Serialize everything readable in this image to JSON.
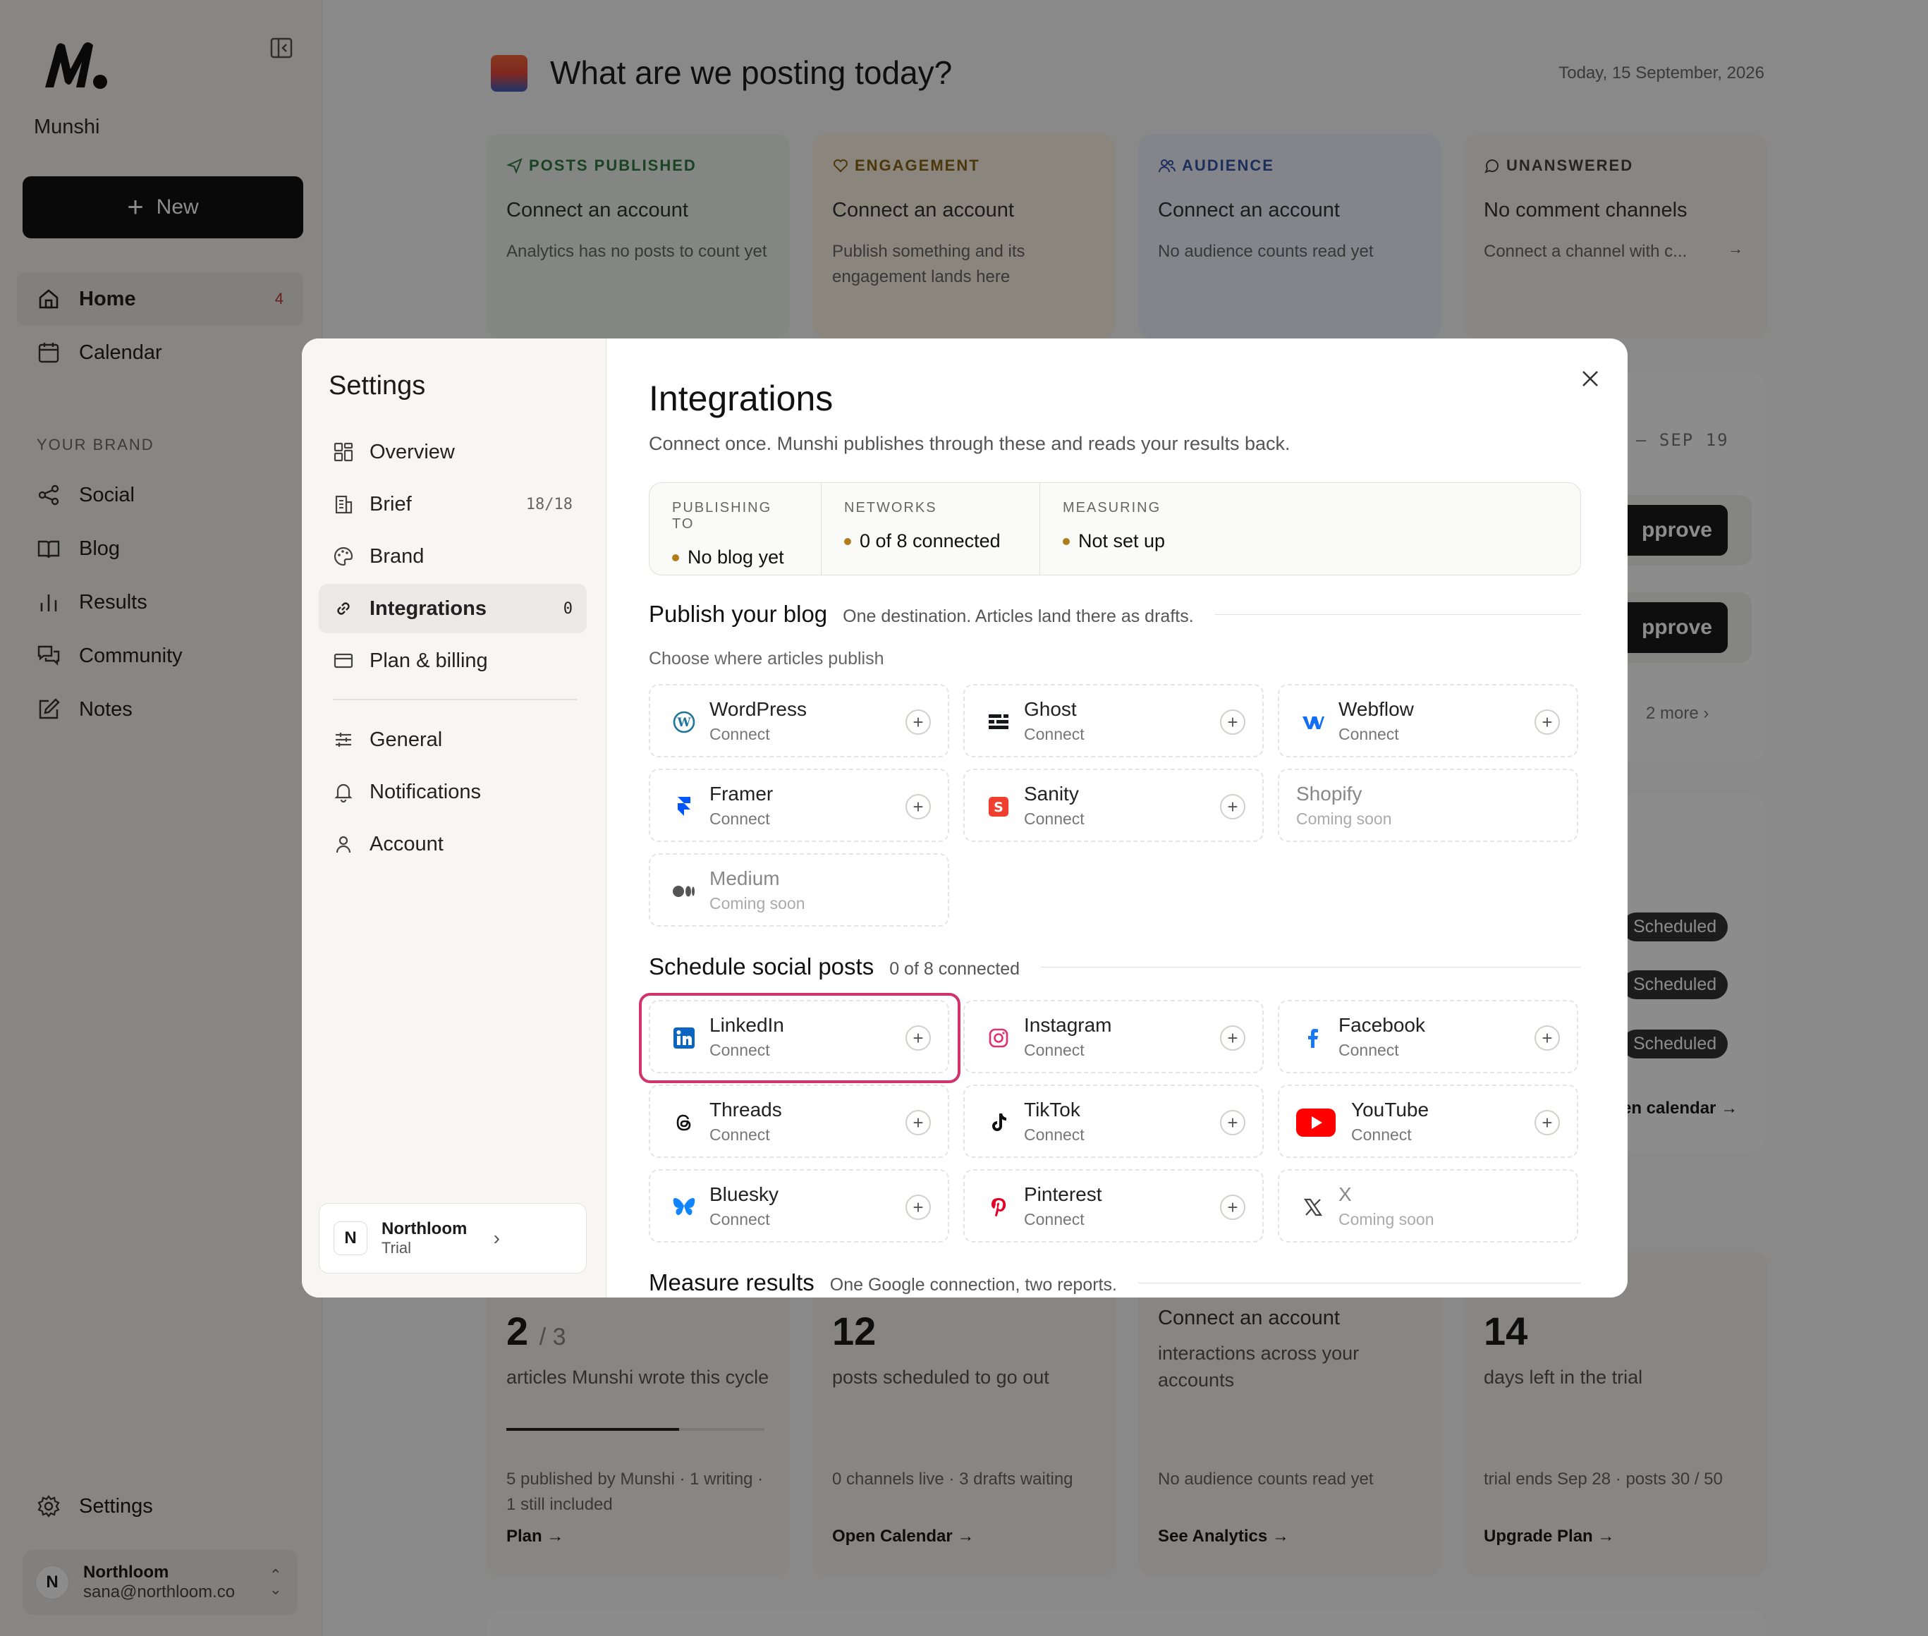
{
  "sidebar": {
    "brand": "Munshi",
    "new_label": "New",
    "nav": [
      {
        "label": "Home",
        "count": "4"
      },
      {
        "label": "Calendar"
      }
    ],
    "section_label": "YOUR BRAND",
    "brand_nav": [
      {
        "label": "Social"
      },
      {
        "label": "Blog"
      },
      {
        "label": "Results"
      },
      {
        "label": "Community"
      },
      {
        "label": "Notes"
      }
    ],
    "settings_label": "Settings",
    "user": {
      "initial": "N",
      "name": "Northloom",
      "email": "sana@northloom.co"
    }
  },
  "main": {
    "title": "What are we posting today?",
    "date": "Today, 15 September, 2026",
    "stats": [
      {
        "label": "POSTS PUBLISHED",
        "heading": "Connect an account",
        "desc": "Analytics has no posts to count yet",
        "color": "#2f7a3e",
        "bg": "#eef5ee"
      },
      {
        "label": "ENGAGEMENT",
        "heading": "Connect an account",
        "desc": "Publish something and its engagement lands here",
        "color": "#8a6414",
        "bg": "#fbf3e3"
      },
      {
        "label": "AUDIENCE",
        "heading": "Connect an account",
        "desc": "No audience counts read yet",
        "color": "#3455a8",
        "bg": "#eef2fb"
      },
      {
        "label": "UNANSWERED",
        "heading": "No comment channels",
        "desc": "Connect a channel with c...",
        "color": "#444444",
        "bg": "#f6f5f3"
      }
    ],
    "week_range": "– SEP 19",
    "approve_label": "pprove",
    "more_label": "2 more",
    "scheduled_label": "Scheduled",
    "open_calendar": "en calendar →",
    "bottom_cards": [
      {
        "big": "2",
        "big_suffix": "/ 3",
        "sub": "articles Munshi wrote this cycle",
        "foot": "5 published by Munshi · 1 writing · 1 still included",
        "link": "Plan →",
        "progress": 0.67
      },
      {
        "big": "12",
        "big_suffix": "",
        "sub": "posts scheduled to go out",
        "foot": "0 channels live · 3 drafts waiting",
        "link": "Open Calendar →"
      },
      {
        "big": "",
        "big_suffix": "",
        "sub_heading": "Connect an account",
        "sub": "interactions across your accounts",
        "foot": "No audience counts read yet",
        "link": "See Analytics →"
      },
      {
        "big": "14",
        "big_suffix": "",
        "sub": "days left in the trial",
        "foot": "trial ends Sep 28 · posts 30 / 50",
        "link": "Upgrade Plan →"
      }
    ]
  },
  "modal": {
    "title": "Settings",
    "nav": [
      {
        "label": "Overview"
      },
      {
        "label": "Brief",
        "badge": "18/18"
      },
      {
        "label": "Brand"
      },
      {
        "label": "Integrations",
        "badge": "0"
      },
      {
        "label": "Plan & billing"
      },
      {
        "label": "General"
      },
      {
        "label": "Notifications"
      },
      {
        "label": "Account"
      }
    ],
    "workspace": {
      "initial": "N",
      "name": "Northloom",
      "plan": "Trial"
    },
    "integrations": {
      "title": "Integrations",
      "subtitle": "Connect once. Munshi publishes through these and reads your results back.",
      "summary": [
        {
          "key": "PUBLISHING TO",
          "value": "No blog yet"
        },
        {
          "key": "NETWORKS",
          "value": "0 of 8 connected"
        },
        {
          "key": "MEASURING",
          "value": "Not set up"
        }
      ],
      "blog_section": {
        "title": "Publish your blog",
        "subtitle": "One destination. Articles land there as drafts.",
        "choose": "Choose where articles publish"
      },
      "blog_tiles": [
        {
          "name": "WordPress",
          "status": "Connect"
        },
        {
          "name": "Ghost",
          "status": "Connect"
        },
        {
          "name": "Webflow",
          "status": "Connect"
        },
        {
          "name": "Framer",
          "status": "Connect"
        },
        {
          "name": "Sanity",
          "status": "Connect"
        },
        {
          "name": "Shopify",
          "status": "Coming soon"
        },
        {
          "name": "Medium",
          "status": "Coming soon"
        }
      ],
      "social_section": {
        "title": "Schedule social posts",
        "subtitle": "0 of 8 connected"
      },
      "social_tiles": [
        {
          "name": "LinkedIn",
          "status": "Connect"
        },
        {
          "name": "Instagram",
          "status": "Connect"
        },
        {
          "name": "Facebook",
          "status": "Connect"
        },
        {
          "name": "Threads",
          "status": "Connect"
        },
        {
          "name": "TikTok",
          "status": "Connect"
        },
        {
          "name": "YouTube",
          "status": "Connect"
        },
        {
          "name": "Bluesky",
          "status": "Connect"
        },
        {
          "name": "Pinterest",
          "status": "Connect"
        },
        {
          "name": "X",
          "status": "Coming soon"
        }
      ],
      "measure_section": {
        "title": "Measure results",
        "subtitle": "One Google connection, two reports."
      }
    }
  },
  "colors": {
    "accent_dark": "#111111",
    "highlight": "#d0346a",
    "status_dot": "#b07d1a"
  }
}
